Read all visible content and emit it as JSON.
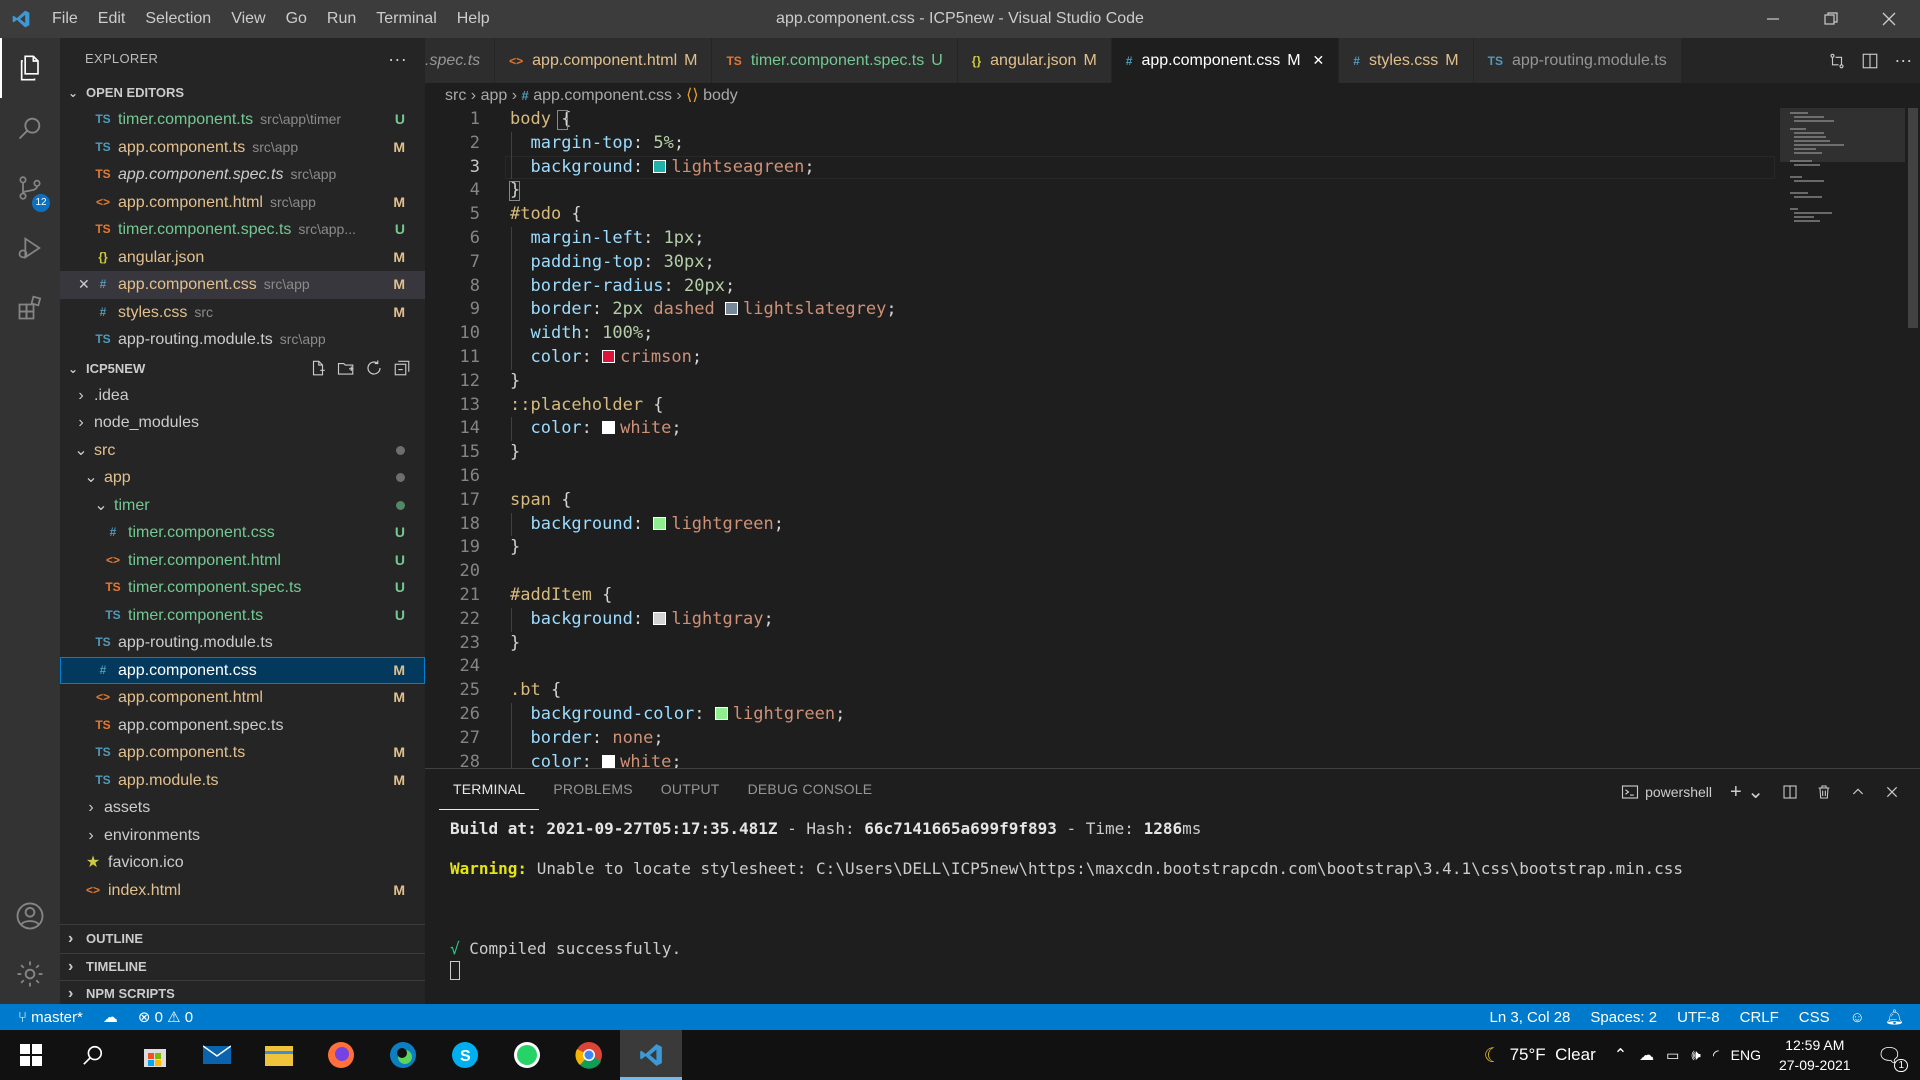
{
  "app": {
    "window_title": "app.component.css - ICP5new - Visual Studio Code",
    "menu": [
      "File",
      "Edit",
      "Selection",
      "View",
      "Go",
      "Run",
      "Terminal",
      "Help"
    ]
  },
  "activity": {
    "scm_badge": "12"
  },
  "sidebar": {
    "header": "EXPLORER",
    "open_editors_title": "OPEN EDITORS",
    "open_editors": [
      {
        "icon": "TS",
        "name": "timer.component.ts",
        "path": "src\\app\\timer",
        "status": "U",
        "kind": "ts"
      },
      {
        "icon": "TS",
        "name": "app.component.ts",
        "path": "src\\app",
        "status": "M",
        "kind": "ts"
      },
      {
        "icon": "TS",
        "name": "app.component.spec.ts",
        "path": "src\\app",
        "status": "",
        "kind": "spec"
      },
      {
        "icon": "<>",
        "name": "app.component.html",
        "path": "src\\app",
        "status": "M",
        "kind": "html"
      },
      {
        "icon": "TS",
        "name": "timer.component.spec.ts",
        "path": "src\\app...",
        "status": "U",
        "kind": "spec"
      },
      {
        "icon": "{}",
        "name": "angular.json",
        "path": "",
        "status": "M",
        "kind": "json"
      },
      {
        "icon": "#",
        "name": "app.component.css",
        "path": "src\\app",
        "status": "M",
        "kind": "css"
      },
      {
        "icon": "#",
        "name": "styles.css",
        "path": "src",
        "status": "M",
        "kind": "css"
      },
      {
        "icon": "TS",
        "name": "app-routing.module.ts",
        "path": "src\\app",
        "status": "",
        "kind": "ts"
      }
    ],
    "project_title": "ICP5NEW",
    "tree": [
      {
        "label": ".idea",
        "type": "folder",
        "depth": 0,
        "open": false
      },
      {
        "label": "node_modules",
        "type": "folder",
        "depth": 0,
        "open": false
      },
      {
        "label": "src",
        "type": "folder",
        "depth": 0,
        "open": true
      },
      {
        "label": "app",
        "type": "folder",
        "depth": 1,
        "open": true
      },
      {
        "label": "timer",
        "type": "folder",
        "depth": 2,
        "open": true
      },
      {
        "icon": "#",
        "label": "timer.component.css",
        "depth": 3,
        "status": "U",
        "kind": "css"
      },
      {
        "icon": "<>",
        "label": "timer.component.html",
        "depth": 3,
        "status": "U",
        "kind": "html"
      },
      {
        "icon": "TS",
        "label": "timer.component.spec.ts",
        "depth": 3,
        "status": "U",
        "kind": "spec"
      },
      {
        "icon": "TS",
        "label": "timer.component.ts",
        "depth": 3,
        "status": "U",
        "kind": "ts"
      },
      {
        "icon": "TS",
        "label": "app-routing.module.ts",
        "depth": 2,
        "status": "",
        "kind": "ts"
      },
      {
        "icon": "#",
        "label": "app.component.css",
        "depth": 2,
        "status": "M",
        "kind": "css"
      },
      {
        "icon": "<>",
        "label": "app.component.html",
        "depth": 2,
        "status": "M",
        "kind": "html"
      },
      {
        "icon": "TS",
        "label": "app.component.spec.ts",
        "depth": 2,
        "status": "",
        "kind": "spec"
      },
      {
        "icon": "TS",
        "label": "app.component.ts",
        "depth": 2,
        "status": "M",
        "kind": "ts"
      },
      {
        "icon": "TS",
        "label": "app.module.ts",
        "depth": 2,
        "status": "M",
        "kind": "ts"
      },
      {
        "label": "assets",
        "type": "folder",
        "depth": 1,
        "open": false
      },
      {
        "label": "environments",
        "type": "folder",
        "depth": 1,
        "open": false
      },
      {
        "icon": "★",
        "label": "favicon.ico",
        "depth": 1,
        "status": "",
        "kind": "json"
      },
      {
        "icon": "<>",
        "label": "index.html",
        "depth": 1,
        "status": "M",
        "kind": "html"
      }
    ],
    "bottom_sections": [
      "OUTLINE",
      "TIMELINE",
      "NPM SCRIPTS"
    ]
  },
  "tabs": [
    {
      "icon": "",
      "label": ".spec.ts",
      "status": "",
      "kind": "spec"
    },
    {
      "icon": "<>",
      "label": "app.component.html",
      "status": "M",
      "kind": "html"
    },
    {
      "icon": "TS",
      "label": "timer.component.spec.ts",
      "status": "U",
      "kind": "spec"
    },
    {
      "icon": "{}",
      "label": "angular.json",
      "status": "M",
      "kind": "json"
    },
    {
      "icon": "#",
      "label": "app.component.css",
      "status": "M",
      "kind": "css",
      "active": true
    },
    {
      "icon": "#",
      "label": "styles.css",
      "status": "M",
      "kind": "css"
    },
    {
      "icon": "TS",
      "label": "app-routing.module.ts",
      "status": "",
      "kind": "ts"
    }
  ],
  "breadcrumb": {
    "src": "src",
    "app": "app",
    "file": "app.component.css",
    "symbol": "body"
  },
  "code": [
    [
      [
        "sel",
        "body"
      ],
      [
        "p",
        " {"
      ]
    ],
    [
      [
        "p",
        "  "
      ],
      [
        "prop",
        "margin-top"
      ],
      [
        "p",
        ": "
      ],
      [
        "num",
        "5%"
      ],
      [
        "p",
        ";"
      ]
    ],
    [
      [
        "p",
        "  "
      ],
      [
        "prop",
        "background"
      ],
      [
        "p",
        ": "
      ],
      [
        "sw",
        "#20b2aa"
      ],
      [
        "val",
        "lightseagreen"
      ],
      [
        "p",
        ";"
      ]
    ],
    [
      [
        "p",
        "}"
      ]
    ],
    [
      [
        "sel",
        "#todo"
      ],
      [
        "p",
        " {"
      ]
    ],
    [
      [
        "p",
        "  "
      ],
      [
        "prop",
        "margin-left"
      ],
      [
        "p",
        ": "
      ],
      [
        "num",
        "1px"
      ],
      [
        "p",
        ";"
      ]
    ],
    [
      [
        "p",
        "  "
      ],
      [
        "prop",
        "padding-top"
      ],
      [
        "p",
        ": "
      ],
      [
        "num",
        "30px"
      ],
      [
        "p",
        ";"
      ]
    ],
    [
      [
        "p",
        "  "
      ],
      [
        "prop",
        "border-radius"
      ],
      [
        "p",
        ": "
      ],
      [
        "num",
        "20px"
      ],
      [
        "p",
        ";"
      ]
    ],
    [
      [
        "p",
        "  "
      ],
      [
        "prop",
        "border"
      ],
      [
        "p",
        ": "
      ],
      [
        "num",
        "2px"
      ],
      [
        "p",
        " "
      ],
      [
        "val",
        "dashed"
      ],
      [
        "p",
        " "
      ],
      [
        "sw",
        "#778899"
      ],
      [
        "val",
        "lightslategrey"
      ],
      [
        "p",
        ";"
      ]
    ],
    [
      [
        "p",
        "  "
      ],
      [
        "prop",
        "width"
      ],
      [
        "p",
        ": "
      ],
      [
        "num",
        "100%"
      ],
      [
        "p",
        ";"
      ]
    ],
    [
      [
        "p",
        "  "
      ],
      [
        "prop",
        "color"
      ],
      [
        "p",
        ": "
      ],
      [
        "sw",
        "#dc143c"
      ],
      [
        "val",
        "crimson"
      ],
      [
        "p",
        ";"
      ]
    ],
    [
      [
        "p",
        "}"
      ]
    ],
    [
      [
        "sel",
        "::placeholder"
      ],
      [
        "p",
        " {"
      ]
    ],
    [
      [
        "p",
        "  "
      ],
      [
        "prop",
        "color"
      ],
      [
        "p",
        ": "
      ],
      [
        "sw",
        "#ffffff"
      ],
      [
        "val",
        "white"
      ],
      [
        "p",
        ";"
      ]
    ],
    [
      [
        "p",
        "}"
      ]
    ],
    [],
    [
      [
        "sel",
        "span"
      ],
      [
        "p",
        " {"
      ]
    ],
    [
      [
        "p",
        "  "
      ],
      [
        "prop",
        "background"
      ],
      [
        "p",
        ": "
      ],
      [
        "sw",
        "#90ee90"
      ],
      [
        "val",
        "lightgreen"
      ],
      [
        "p",
        ";"
      ]
    ],
    [
      [
        "p",
        "}"
      ]
    ],
    [],
    [
      [
        "sel",
        "#addItem"
      ],
      [
        "p",
        " {"
      ]
    ],
    [
      [
        "p",
        "  "
      ],
      [
        "prop",
        "background"
      ],
      [
        "p",
        ": "
      ],
      [
        "sw",
        "#d3d3d3"
      ],
      [
        "val",
        "lightgray"
      ],
      [
        "p",
        ";"
      ]
    ],
    [
      [
        "p",
        "}"
      ]
    ],
    [],
    [
      [
        "sel",
        ".bt"
      ],
      [
        "p",
        " {"
      ]
    ],
    [
      [
        "p",
        "  "
      ],
      [
        "prop",
        "background-color"
      ],
      [
        "p",
        ": "
      ],
      [
        "sw",
        "#90ee90"
      ],
      [
        "val",
        "lightgreen"
      ],
      [
        "p",
        ";"
      ]
    ],
    [
      [
        "p",
        "  "
      ],
      [
        "prop",
        "border"
      ],
      [
        "p",
        ": "
      ],
      [
        "val",
        "none"
      ],
      [
        "p",
        ";"
      ]
    ],
    [
      [
        "p",
        "  "
      ],
      [
        "prop",
        "color"
      ],
      [
        "p",
        ": "
      ],
      [
        "sw",
        "#ffffff"
      ],
      [
        "val",
        "white"
      ],
      [
        "p",
        ";"
      ]
    ]
  ],
  "current_line": 3,
  "panel": {
    "tabs": [
      "TERMINAL",
      "PROBLEMS",
      "OUTPUT",
      "DEBUG CONSOLE"
    ],
    "shell": "powershell",
    "build_prefix": "Build at: ",
    "build_date": "2021-09-27T05:17:35.481Z",
    "hash_sep": " - Hash: ",
    "hash": "66c7141665a699f9f893",
    "time_sep": " - Time: ",
    "time": "1286",
    "time_unit": "ms",
    "warning_label": "Warning:",
    "warning_text": " Unable to locate stylesheet: C:\\Users\\DELL\\ICP5new\\https:\\maxcdn.bootstrapcdn.com\\bootstrap\\3.4.1\\css\\bootstrap.min.css",
    "success_mark": "√",
    "success_text": " Compiled successfully."
  },
  "status": {
    "branch": "master*",
    "errors": "0",
    "warnings": "0",
    "position": "Ln 3, Col 28",
    "spaces": "Spaces: 2",
    "encoding": "UTF-8",
    "eol": "CRLF",
    "language": "CSS"
  },
  "taskbar": {
    "weather": "75°F  Clear",
    "lang": "ENG",
    "time": "12:59 AM",
    "date": "27-09-2021",
    "notif_count": "1"
  },
  "colors": {
    "accent": "#007acc",
    "modified": "#e2c08d",
    "untracked": "#73c991"
  }
}
